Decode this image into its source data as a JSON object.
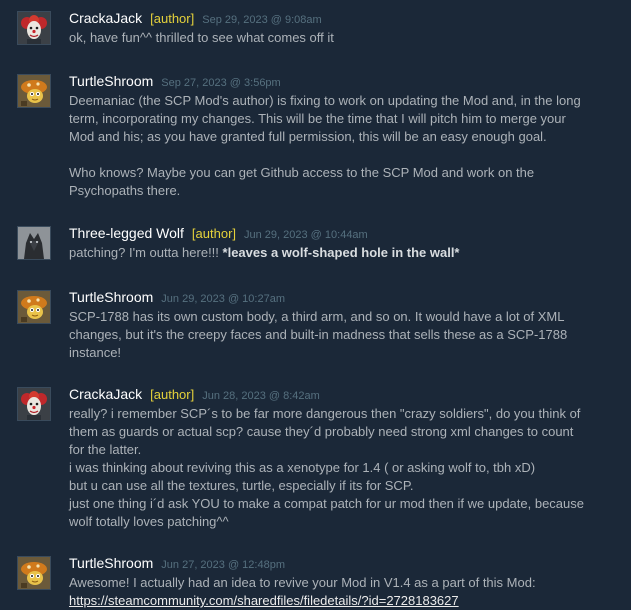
{
  "comments": [
    {
      "author": "CrackaJack",
      "badge": "[author]",
      "time": "Sep 29, 2023 @ 9:08am",
      "avatar": "clown-avatar",
      "lines": [
        "ok, have fun^^ thrilled to see what comes off it"
      ]
    },
    {
      "author": "TurtleShroom",
      "badge": "",
      "time": "Sep 27, 2023 @ 3:56pm",
      "avatar": "turtle-avatar",
      "lines": [
        "Deemaniac (the SCP Mod's author) is fixing to work on updating the Mod and, in the long",
        "term, incorporating my changes. This will be the time that I will pitch him to merge your",
        "Mod and his; as you have granted full permission, this will be an easy enough goal.",
        "",
        "Who knows? Maybe you can get Github access to the SCP Mod and work on the",
        "Psychopaths there."
      ]
    },
    {
      "author": "Three-legged Wolf",
      "badge": "[author]",
      "time": "Jun 29, 2023 @ 10:44am",
      "avatar": "wolf-avatar",
      "line_plain": "patching? I'm outta here!!! ",
      "line_bold": "*leaves a wolf-shaped hole in the wall*"
    },
    {
      "author": "TurtleShroom",
      "badge": "",
      "time": "Jun 29, 2023 @ 10:27am",
      "avatar": "turtle-avatar",
      "lines": [
        "SCP-1788 has its own custom body, a third arm, and so on. It would have a lot of XML",
        "changes, but it's the creepy faces and built-in madness that sells these as a SCP-1788",
        "instance!"
      ]
    },
    {
      "author": "CrackaJack",
      "badge": "[author]",
      "time": "Jun 28, 2023 @ 8:42am",
      "avatar": "clown-avatar",
      "lines": [
        "really? i remember SCP´s to be far more dangerous then \"crazy soldiers\", do you think of",
        "them as guards or actual scp? cause they´d probably need strong xml changes to count",
        "for the latter.",
        "i was thinking about reviving this as a xenotype for 1.4 ( or asking wolf to, tbh xD)",
        "but u can use all the textures, turtle, especially if its for SCP.",
        "just one thing i´d ask YOU to make a compat patch for ur mod then if we update, because",
        "wolf totally loves patching^^"
      ]
    },
    {
      "author": "TurtleShroom",
      "badge": "",
      "time": "Jun 27, 2023 @ 12:48pm",
      "avatar": "turtle-avatar",
      "lines": [
        "Awesome! I actually had an idea to revive your Mod in V1.4 as a part of this Mod:"
      ],
      "link": "https://steamcommunity.com/sharedfiles/filedetails/?id=2728183627"
    }
  ],
  "colors": {
    "background": "#1b2838",
    "author": "#ffffff",
    "badge": "#e4d13b",
    "timestamp": "#56707f",
    "text": "#acb2b8"
  }
}
